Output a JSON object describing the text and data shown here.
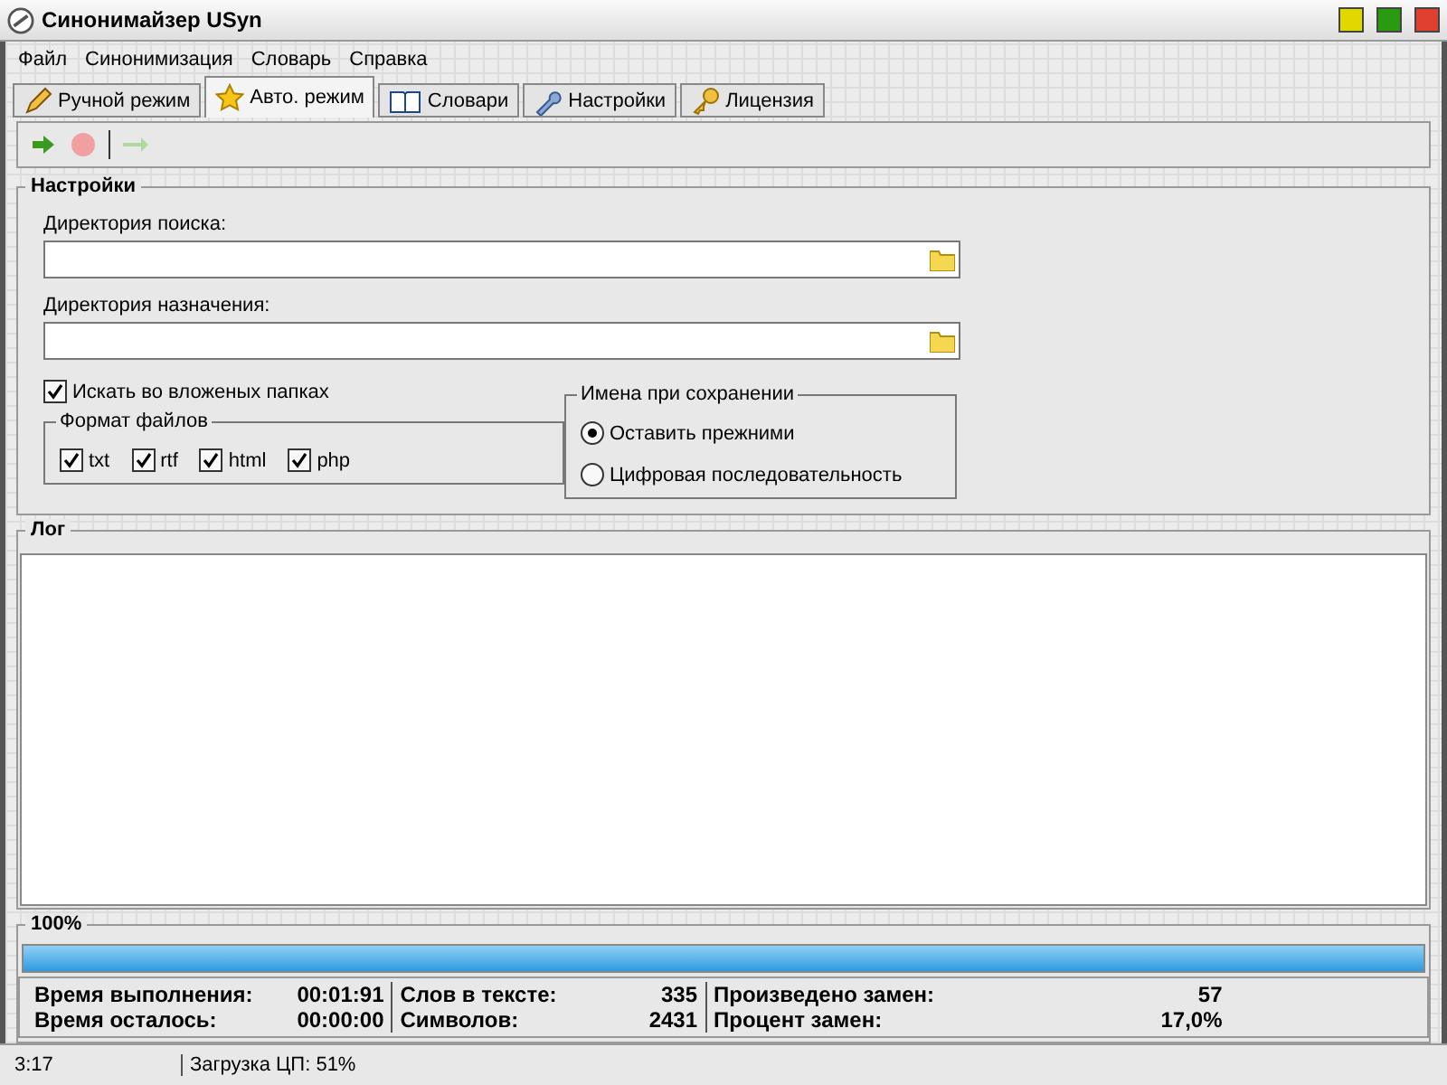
{
  "window": {
    "title": "Синонимайзер USyn",
    "controls": [
      {
        "kind": "minimize"
      },
      {
        "kind": "maximize"
      },
      {
        "kind": "close"
      }
    ]
  },
  "menu": [
    "Файл",
    "Синонимизация",
    "Словарь",
    "Справка"
  ],
  "tabs": [
    {
      "label": "Ручной режим",
      "kind": "pencil",
      "selected": false
    },
    {
      "label": "Авто. режим",
      "kind": "star",
      "selected": true
    },
    {
      "label": "Словари",
      "kind": "book",
      "selected": false
    },
    {
      "label": "Настройки",
      "kind": "wrench",
      "selected": false
    },
    {
      "label": "Лицензия",
      "kind": "key",
      "selected": false
    }
  ],
  "toolbar": [
    {
      "kind": "start",
      "disabled": false
    },
    {
      "kind": "stop",
      "disabled": true
    },
    {
      "kind": "forward",
      "disabled": true
    }
  ],
  "settings": {
    "title": "Настройки",
    "fields": [
      {
        "label": "Директория поиска:"
      },
      {
        "label": "Директория назначения:"
      }
    ],
    "subfolders": {
      "label": "Искать во вложеных папках",
      "checked": true
    },
    "formats": {
      "title": "Формат файлов",
      "items": [
        {
          "label": "txt",
          "checked": true
        },
        {
          "label": "rtf",
          "checked": true
        },
        {
          "label": "html",
          "checked": true
        },
        {
          "label": "php",
          "checked": true
        }
      ]
    },
    "naming": {
      "title": "Имена при сохранении",
      "options": [
        {
          "label": "Оставить прежними",
          "selected": true
        },
        {
          "label": "Цифровая последовательность",
          "selected": false
        }
      ]
    }
  },
  "log": {
    "title": "Лог"
  },
  "progress": {
    "label": "100%",
    "level": 1
  },
  "stats": [
    [
      {
        "label": "Время выполнения:",
        "value": "00:01:91"
      },
      {
        "label": "Время осталось:",
        "value": "00:00:00"
      }
    ],
    [
      {
        "label": "Слов в тексте:",
        "value": "335"
      },
      {
        "label": "Символов:",
        "value": "2431"
      }
    ],
    [
      {
        "label": "Произведено замен:",
        "value": "57"
      },
      {
        "label": "Процент замен:",
        "value": "17,0%"
      }
    ]
  ],
  "status_bar": [
    "3:17",
    "Загрузка ЦП: 51%"
  ]
}
